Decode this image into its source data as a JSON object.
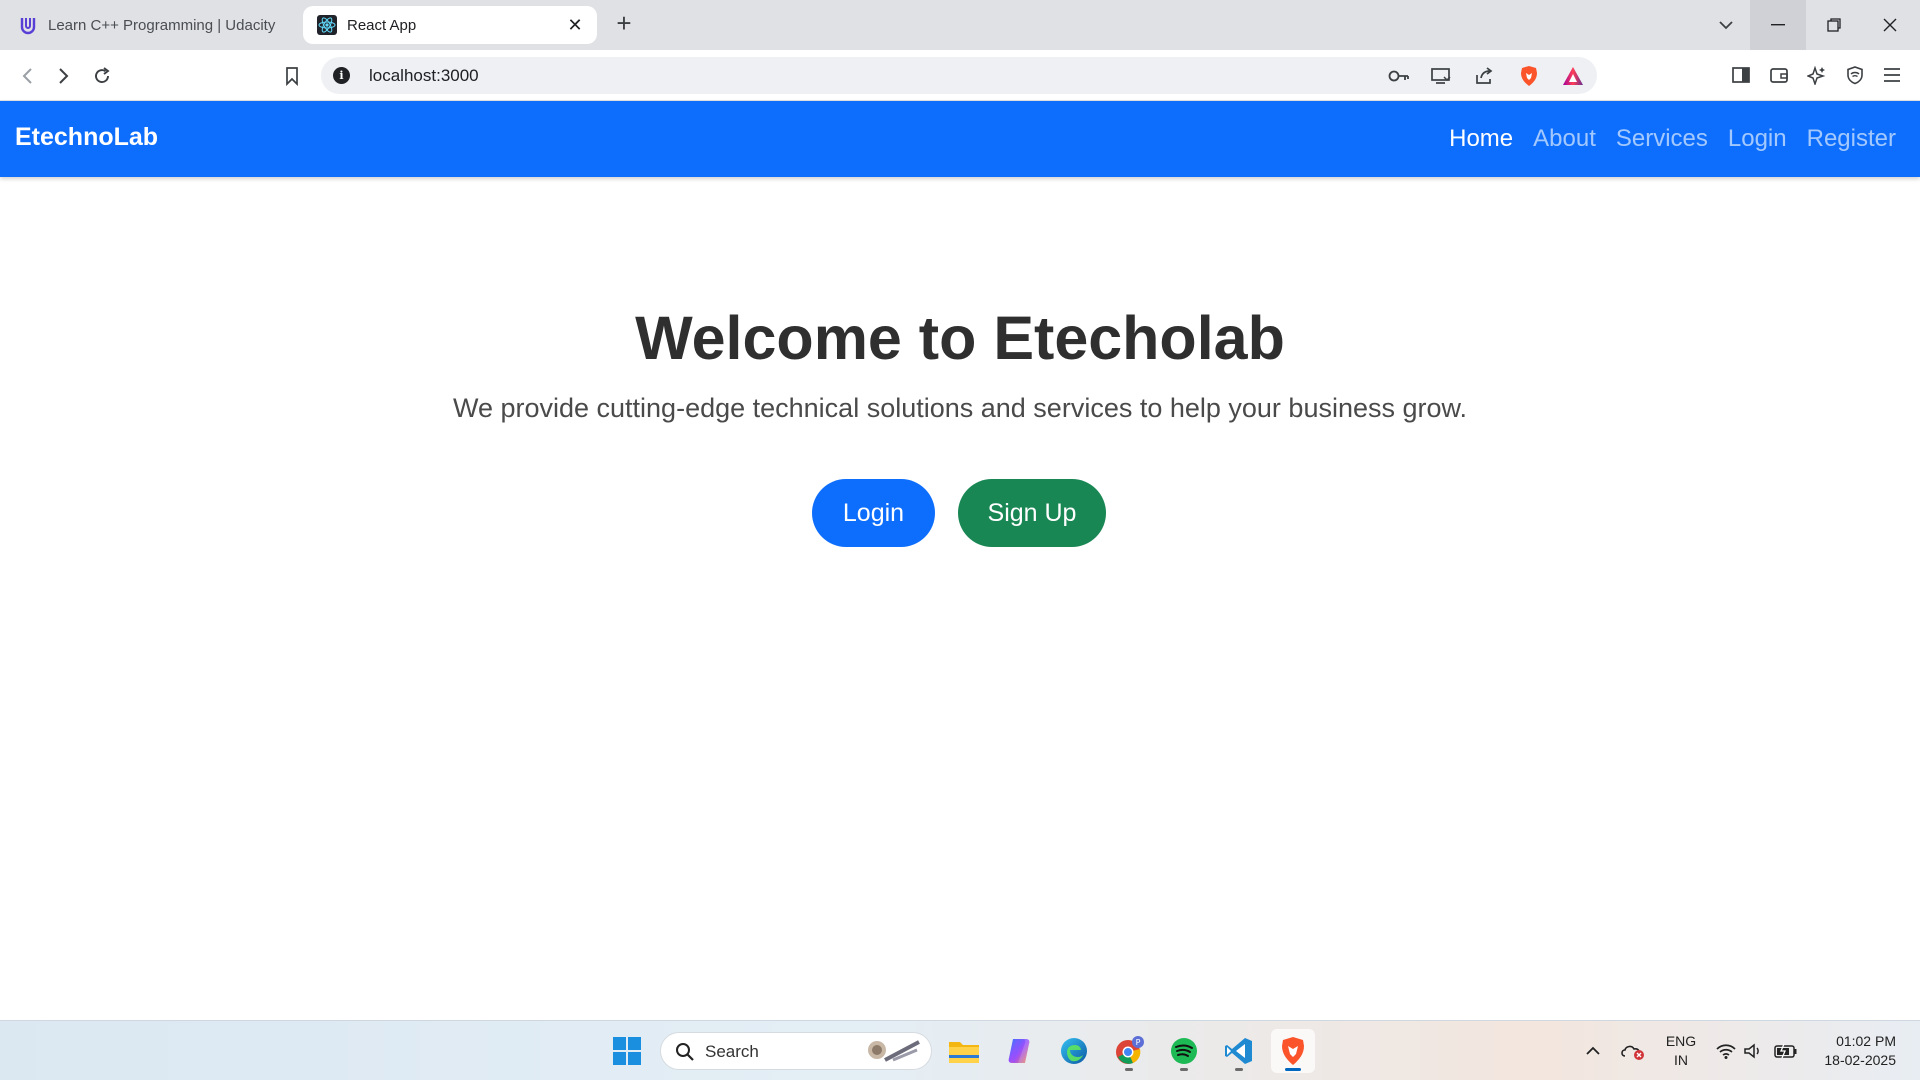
{
  "browser": {
    "tabs": [
      {
        "title": "Learn C++ Programming | Udacity",
        "favicon": "udacity-icon",
        "active": false
      },
      {
        "title": "React App",
        "favicon": "react-icon",
        "active": true
      }
    ],
    "address": "localhost:3000"
  },
  "navbar": {
    "brand": "EtechnoLab",
    "links": [
      {
        "label": "Home",
        "active": true
      },
      {
        "label": "About",
        "active": false
      },
      {
        "label": "Services",
        "active": false
      },
      {
        "label": "Login",
        "active": false
      },
      {
        "label": "Register",
        "active": false
      }
    ]
  },
  "hero": {
    "title": "Welcome to Etecholab",
    "subtitle": "We provide cutting-edge technical solutions and services to help your business grow.",
    "login_label": "Login",
    "signup_label": "Sign Up"
  },
  "taskbar": {
    "search_label": "Search",
    "language": [
      "ENG",
      "IN"
    ],
    "time": "01:02 PM",
    "date": "18-02-2025"
  },
  "colors": {
    "navbar": "#0d6efd",
    "login_button": "#0d6efd",
    "signup_button": "#198754"
  }
}
